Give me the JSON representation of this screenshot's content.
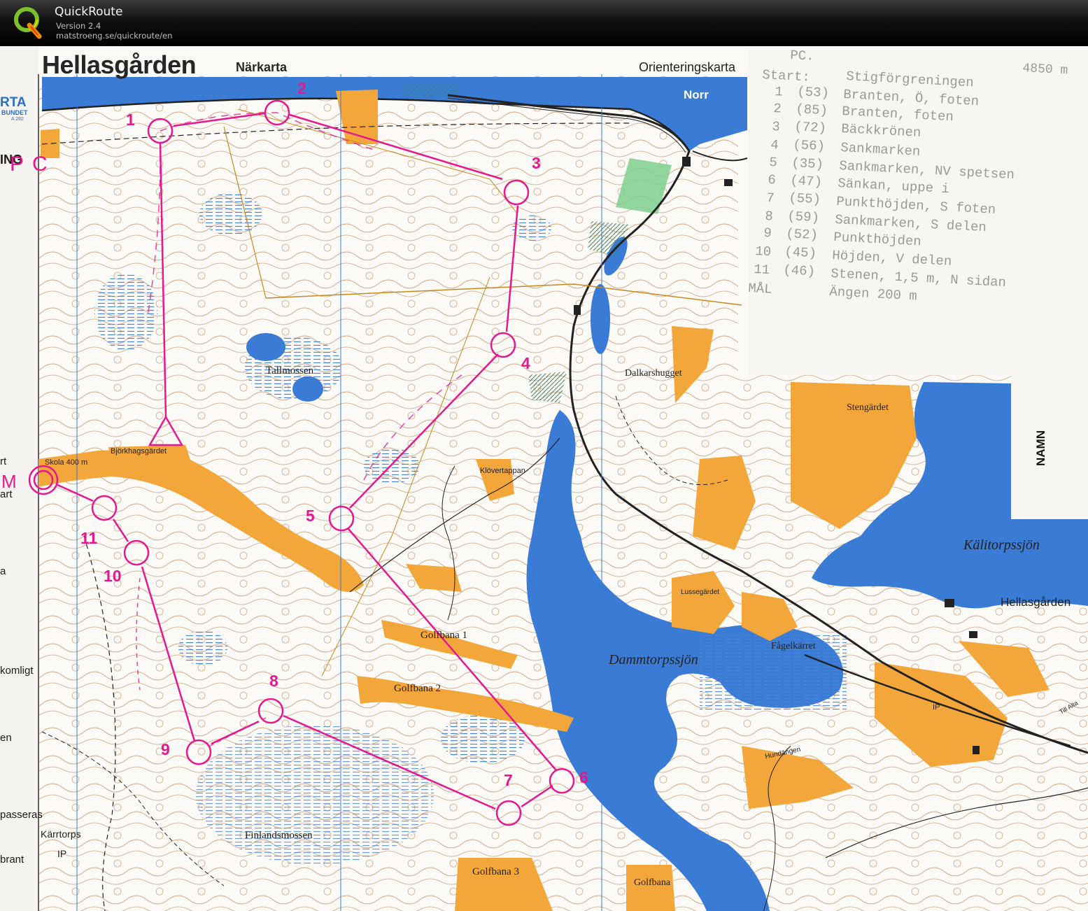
{
  "app": {
    "name": "QuickRoute",
    "version": "Version 2.4",
    "url": "matstroeng.se/quickroute/en"
  },
  "map": {
    "title": "Hellasgården",
    "subtitle": "Närkarta",
    "type_label": "Orienteringskarta",
    "north_label": "Norr",
    "edge_texts": [
      "RTA",
      "BUNDET",
      "A 282",
      "ING",
      "rt",
      "art",
      "a",
      "komligt",
      "en",
      "passeras",
      "brant"
    ],
    "place_names": {
      "tallmossen": "Tallmossen",
      "bjorkhagsgardet": "Björkhagsgärdet",
      "skola": "Skola 400 m",
      "klovertappan": "Klövertappan",
      "dalkarshugget": "Dalkarshugget",
      "stengardet": "Stengärdet",
      "kalitorpssjon": "Kälitorpssjön",
      "hellasgarden": "Hellasgården",
      "lussegardet": "Lussegärdet",
      "fagelkarret": "Fågelkärret",
      "dammtorpssjon": "Dammtorpssjön",
      "golfbana1": "Golfbana 1",
      "golfbana2": "Golfbana 2",
      "golfbana3": "Golfbana 3",
      "golfbana": "Golfbana",
      "finlandsmossen": "Finlandsmossen",
      "karrtorps": "Kärrtorps",
      "ip": "IP",
      "ip_small": "IP",
      "hundangen": "Hundängen",
      "till_alta": "Till Alta"
    }
  },
  "course": {
    "color": "#e6178f",
    "marks": {
      "pc": "PC",
      "m": "M"
    },
    "controls": [
      {
        "label": "1"
      },
      {
        "label": "2"
      },
      {
        "label": "3"
      },
      {
        "label": "4"
      },
      {
        "label": "5"
      },
      {
        "label": "6"
      },
      {
        "label": "7"
      },
      {
        "label": "8"
      },
      {
        "label": "9"
      },
      {
        "label": "10"
      },
      {
        "label": "11"
      }
    ]
  },
  "descriptions": {
    "header": "PC.",
    "distance": "4850 m",
    "start_label": "Start:",
    "start_text": "Stigförgreningen",
    "rows": [
      {
        "num": "1",
        "code": "(53)",
        "text": "Branten, Ö, foten"
      },
      {
        "num": "2",
        "code": "(85)",
        "text": "Branten, foten"
      },
      {
        "num": "3",
        "code": "(72)",
        "text": "Bäckkrönen"
      },
      {
        "num": "4",
        "code": "(56)",
        "text": "Sankmarken"
      },
      {
        "num": "5",
        "code": "(35)",
        "text": "Sankmarken, NV spetsen"
      },
      {
        "num": "6",
        "code": "(47)",
        "text": "Sänkan, uppe i"
      },
      {
        "num": "7",
        "code": "(55)",
        "text": "Punkthöjden, S foten"
      },
      {
        "num": "8",
        "code": "(59)",
        "text": "Sankmarken, S delen"
      },
      {
        "num": "9",
        "code": "(52)",
        "text": "Punkthöjden"
      },
      {
        "num": "10",
        "code": "(45)",
        "text": "Höjden, V delen"
      },
      {
        "num": "11",
        "code": "(46)",
        "text": "Stenen, 1,5 m, N sidan"
      }
    ],
    "finish_label": "MÅL",
    "finish_text": "Ängen 200 m",
    "namn_label": "NAMN"
  },
  "colors": {
    "water": "#3a7bd5",
    "open_land": "#f3a63a",
    "contour": "#c98a5c",
    "course": "#e6178f",
    "header_bg": "#0d0d0d"
  }
}
